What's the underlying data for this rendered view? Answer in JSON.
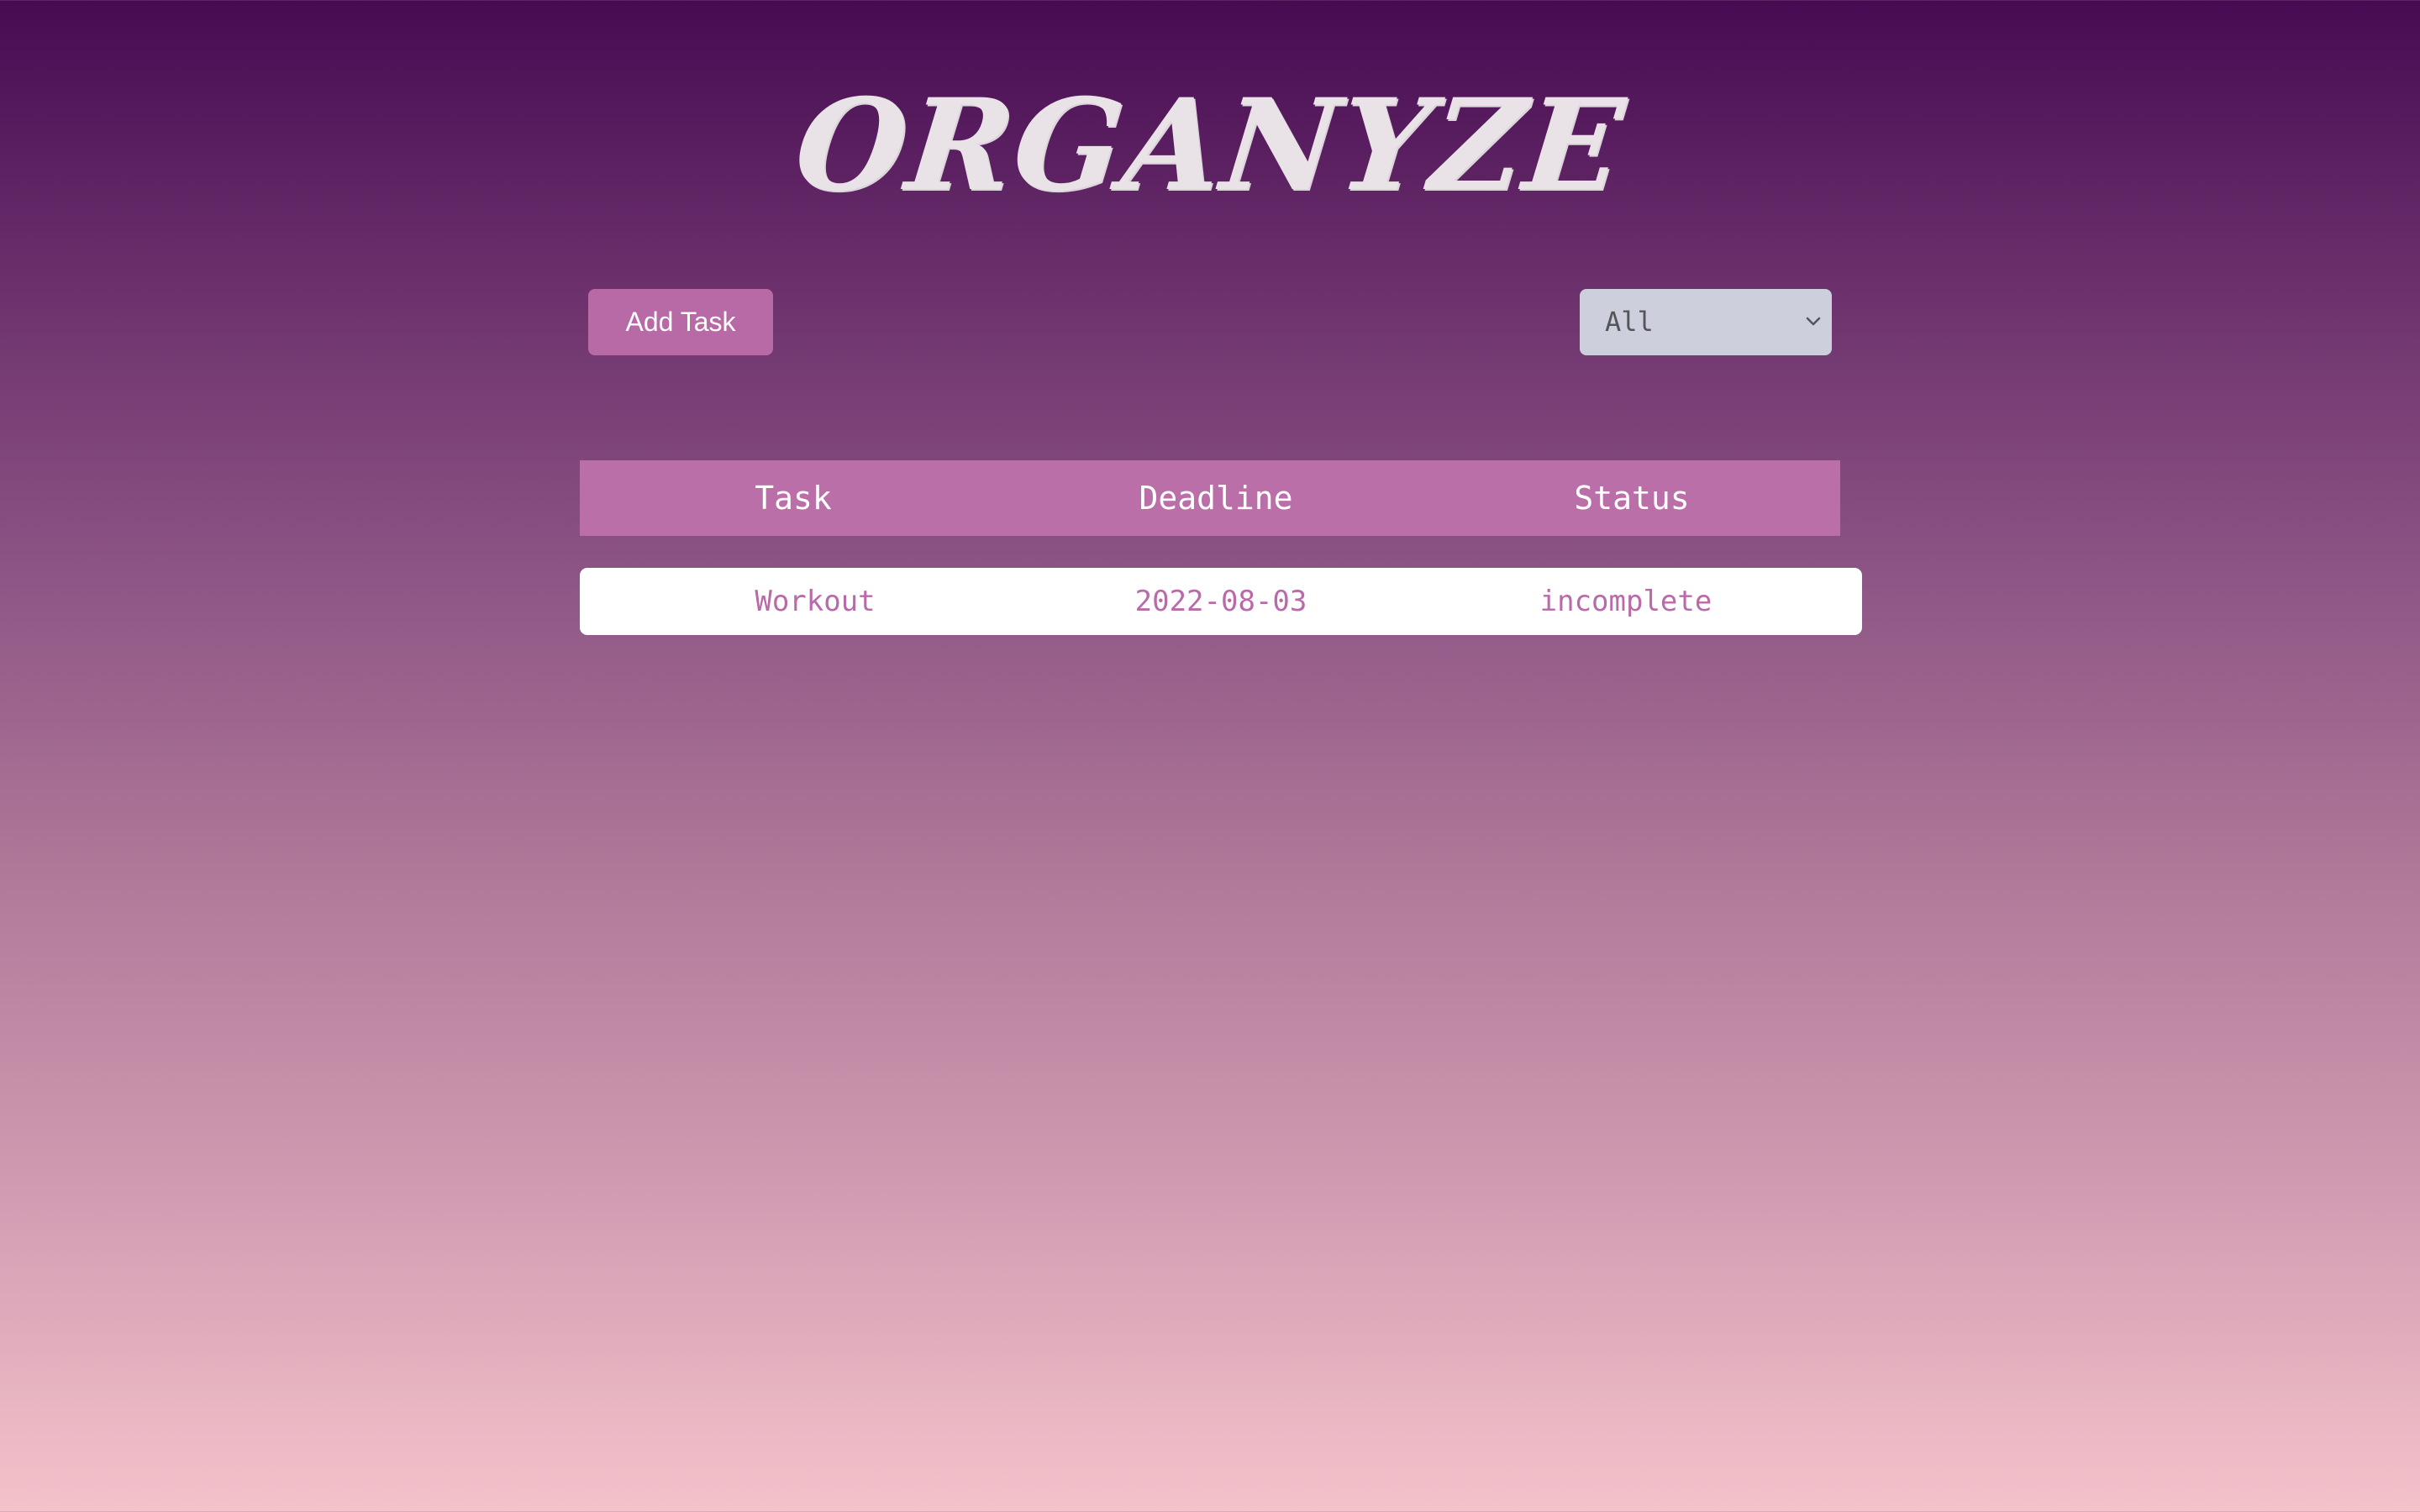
{
  "app": {
    "title": "Organyze"
  },
  "toolbar": {
    "add_label": "Add Task",
    "filter": {
      "selected": "All"
    }
  },
  "table": {
    "headers": [
      "Task",
      "Deadline",
      "Status"
    ],
    "rows": [
      {
        "task": "Workout",
        "deadline": "2022-08-03",
        "status": "incomplete"
      }
    ]
  },
  "colors": {
    "accent": "#bb6fa8",
    "row_text": "#b96aa8",
    "gradient_top": "#460b52",
    "gradient_bottom": "#f4c2ca"
  },
  "icons": {
    "filter_dropdown": "chevron-down-icon"
  }
}
